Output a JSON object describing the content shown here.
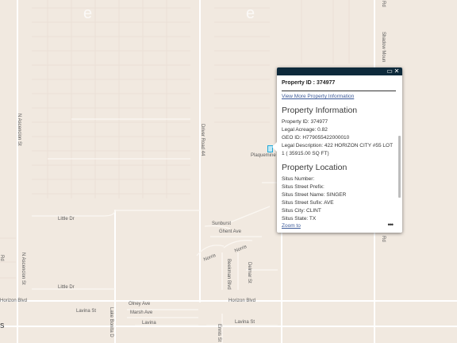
{
  "map": {
    "road_labels": {
      "a": "N Ascencion St",
      "b": "Driver Road 44",
      "c": "Shadow Moun",
      "d": "Rd",
      "e": "Little Dr",
      "f": "Little Dr",
      "g": "Sunburst",
      "h": "Ghent Ave",
      "i": "Norris",
      "j": "Norris",
      "k": "Beekman Blvd",
      "l": "Delmar St",
      "m": "N Ascencion St",
      "n": "Horizon Blvd",
      "o": "Horizon Blvd",
      "p": "Olney Ave",
      "q": "Lavina St",
      "r": "Marsh Ave",
      "s": "Lake Bonita D",
      "t": "Lavina",
      "u": "Lavina St",
      "v": "Ennis St",
      "w": "Plaquemine",
      "x": "Rd",
      "y": "Rd",
      "z": "s",
      "e2": "e",
      "e3": "e"
    }
  },
  "popup": {
    "title": "Property ID : 374977",
    "link": "View More Property Information",
    "section1": "Property Information",
    "rows1": [
      "Property ID: 374977",
      "Legal Acreage: 0.82",
      "GEO ID: H779055422000010",
      "Legal Description: 422 HORIZON CITY #55 LOT 1 ( 35915.00 SQ FT)"
    ],
    "section2": "Property Location",
    "rows2": [
      "Situs Number:",
      "Situs Street Prefix:",
      "Situs Street Name: SINGER",
      "Situs Street Sufix: AVE",
      "Situs City: CLINT",
      "Situs State: TX"
    ],
    "zoom": "Zoom to",
    "more": "•••",
    "maximize_icon": "maximize-icon",
    "close_icon": "close-icon"
  }
}
